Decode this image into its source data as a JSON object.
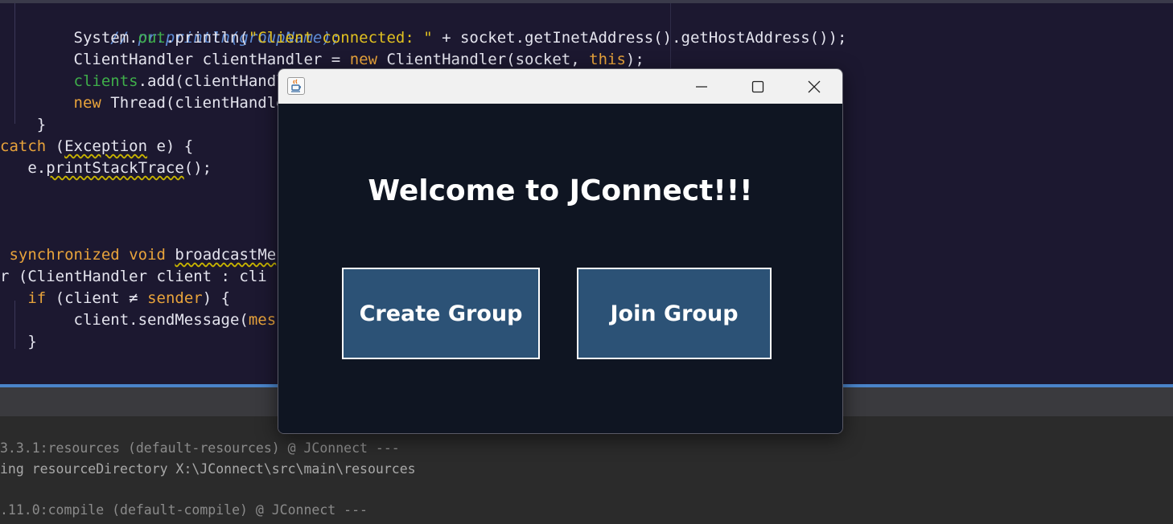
{
  "editor": {
    "lines": [
      "        // pr.println(groupName);",
      "        System.out.println(\"Client connected: \" + socket.getInetAddress().getHostAddress());",
      "        ClientHandler clientHandler = new ClientHandler(socket, this);",
      "        clients.add(clientHandl",
      "        new Thread(clientHandle",
      "    }",
      "catch (Exception e) {",
      "   e.printStackTrace();",
      "",
      "",
      " synchronized void broadcastMe",
      "r (ClientHandler client : cli",
      "   if (client ≠ sender) {",
      "        client.sendMessage(messa",
      "   }"
    ]
  },
  "console": {
    "lines": [
      "3.3.1:resources (default-resources) @ JConnect ---",
      "ing resourceDirectory X:\\JConnect\\src\\main\\resources",
      "",
      ".11.0:compile (default-compile) @ JConnect ---"
    ]
  },
  "window": {
    "icon": "java-icon",
    "controls": [
      "minimize-icon",
      "maximize-icon",
      "close-icon"
    ]
  },
  "app": {
    "welcome_title": "Welcome to JConnect!!!",
    "create_group_label": "Create Group",
    "join_group_label": "Join Group"
  },
  "colors": {
    "editor_bg": "#1c1830",
    "keyword": "#e8a33b",
    "string": "#e0c020",
    "comment": "#5d8cd6",
    "field": "#3fae4a",
    "app_bg": "#0f1522",
    "button_bg": "#2c5276",
    "split_bar": "#4a84c9"
  }
}
